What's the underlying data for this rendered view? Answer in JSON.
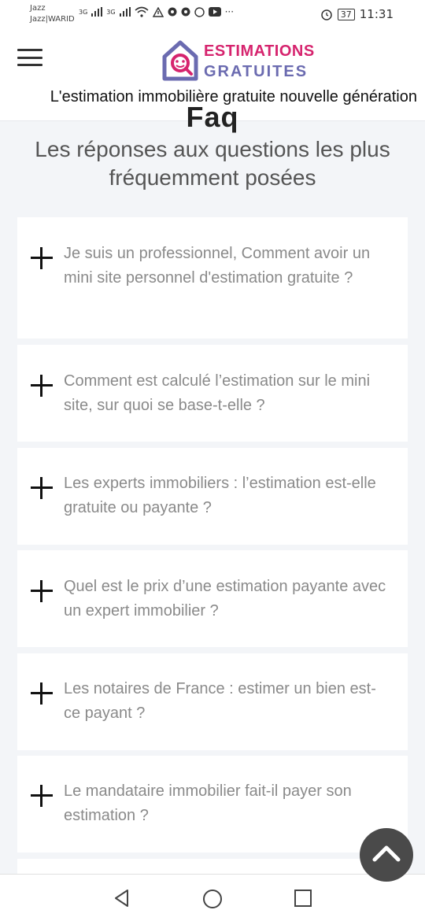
{
  "status_bar": {
    "carrier_line1": "Jazz",
    "carrier_line2": "Jazz|WARID",
    "network1": "3G",
    "network2": "3G",
    "more": "···",
    "battery": "37",
    "time": "11:31"
  },
  "header": {
    "logo_line1": "ESTIMATIONS",
    "logo_line2": "GRATUITES",
    "tagline": "L'estimation immobilière gratuite nouvelle génération"
  },
  "faq": {
    "heading": "Faq",
    "subtitle": "Les réponses aux questions les plus fréquemment posées",
    "questions": [
      "Je suis un professionnel, Comment avoir un mini site personnel d'estimation gratuite ?",
      "Comment est calculé l’estimation sur le mini site, sur quoi se base-t-elle ?",
      "Les experts immobiliers : l’estimation est-elle gratuite ou payante ?",
      "Quel est le prix d’une estimation payante avec un expert immobilier ?",
      "Les notaires de France : estimer un bien est-ce payant ?",
      "Le mandataire immobilier fait-il payer son estimation ?"
    ]
  },
  "icons": {
    "menu": "hamburger-menu-icon",
    "expand": "plus-icon",
    "to_top": "chevron-up-icon",
    "nav_back": "back-triangle-icon",
    "nav_home": "home-circle-icon",
    "nav_recents": "recents-square-icon"
  },
  "colors": {
    "brand_pink": "#d6246e",
    "brand_purple": "#6b6bb0",
    "question_text": "#8a8a8a",
    "page_bg": "#f3f5f8"
  }
}
